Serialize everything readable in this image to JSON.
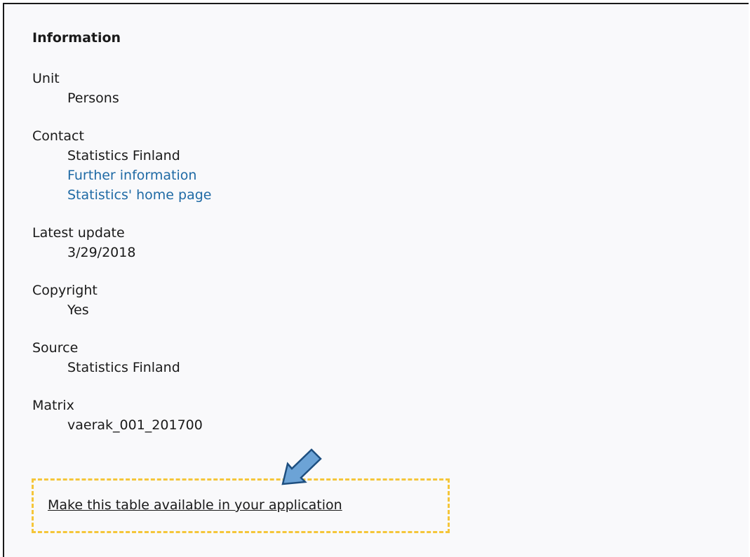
{
  "information": {
    "heading": "Information",
    "groups": [
      {
        "label": "Unit",
        "values": [
          "Persons"
        ]
      },
      {
        "label": "Contact",
        "values": [
          "Statistics Finland"
        ],
        "links": [
          "Further information",
          "Statistics' home page"
        ]
      },
      {
        "label": "Latest update",
        "values": [
          "3/29/2018"
        ]
      },
      {
        "label": "Copyright",
        "values": [
          "Yes"
        ]
      },
      {
        "label": "Source",
        "values": [
          "Statistics Finland"
        ]
      },
      {
        "label": "Matrix",
        "values": [
          "vaerak_001_201700"
        ]
      }
    ]
  },
  "api": {
    "link_label": "Make this table available in your application",
    "highlight_color": "#f5c63a"
  },
  "arrow": {
    "icon": "arrow-down-left-icon",
    "color": "#6ca3d6"
  },
  "colors": {
    "link": "#1f6aa5",
    "text": "#1a1a1a",
    "background": "#f9f9fb"
  }
}
